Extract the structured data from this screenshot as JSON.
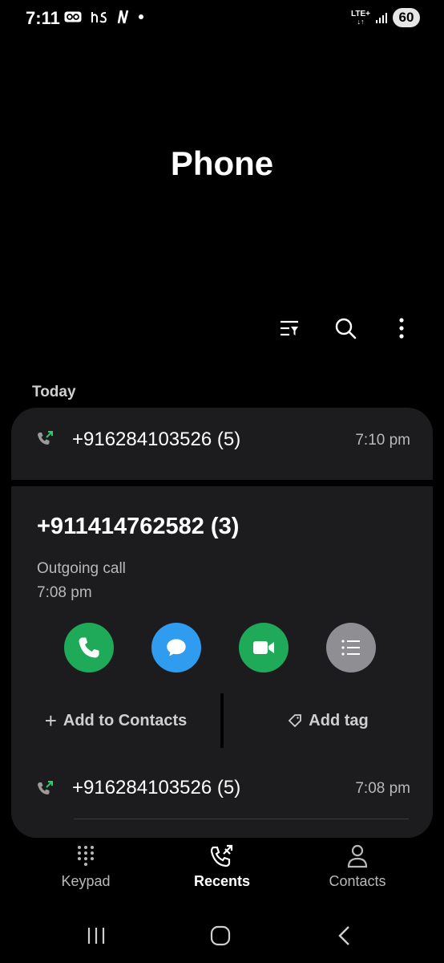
{
  "status_bar": {
    "time": "7:11",
    "network": "LTE+",
    "battery": "60"
  },
  "header": {
    "title": "Phone"
  },
  "toolbar": {
    "filter_icon": "filter-icon",
    "search_icon": "search-icon",
    "more_icon": "more-vert-icon"
  },
  "recents": {
    "section_label": "Today",
    "items": [
      {
        "number": "+916284103526 (5)",
        "time": "7:10 pm",
        "icon": "outgoing-call-icon"
      },
      {
        "number": "+916284103526 (5)",
        "time": "7:08 pm",
        "icon": "outgoing-call-icon"
      }
    ],
    "expanded": {
      "number": "+911414762582 (3)",
      "call_type": "Outgoing call",
      "time": "7:08 pm",
      "actions": [
        "call",
        "message",
        "video-call",
        "details"
      ],
      "add_contacts_label": "Add to Contacts",
      "add_tag_label": "Add tag"
    }
  },
  "bottom_nav": {
    "items": [
      {
        "label": "Keypad",
        "active": false
      },
      {
        "label": "Recents",
        "active": true
      },
      {
        "label": "Contacts",
        "active": false
      }
    ]
  },
  "colors": {
    "call": "#1faa59",
    "message": "#2f9cf0",
    "video": "#1faa59",
    "details": "#8e8e93",
    "outgoing_arrow": "#2ecc71"
  }
}
